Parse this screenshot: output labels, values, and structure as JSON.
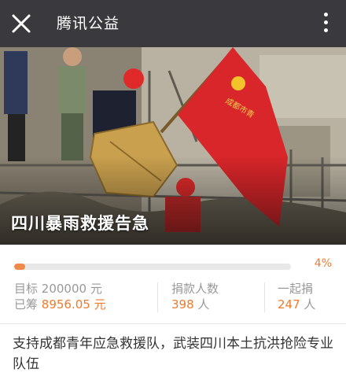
{
  "header": {
    "title": "腾讯公益",
    "close_icon": "close-icon",
    "more_icon": "more-vertical-icon",
    "bg_color": "#3a3a3e"
  },
  "hero": {
    "title": "四川暴雨救援告急",
    "flag_text": "成都市青年应急救援队 · 志愿服务",
    "flag_color": "#d8262a"
  },
  "progress": {
    "percent_label": "4%",
    "fraction": 0.04,
    "accent_color": "#f07a2c"
  },
  "stats": {
    "target_label": "目标",
    "target_value": "200000 元",
    "raised_label": "已筹",
    "raised_value": "8956.05 元",
    "donors_label": "捐款人数",
    "donors_value": "398",
    "donors_unit": "人",
    "together_label": "一起捐",
    "together_value": "247",
    "together_unit": "人"
  },
  "description": "支持成都青年应急救援队，武装四川本土抗洪抢险专业队伍"
}
